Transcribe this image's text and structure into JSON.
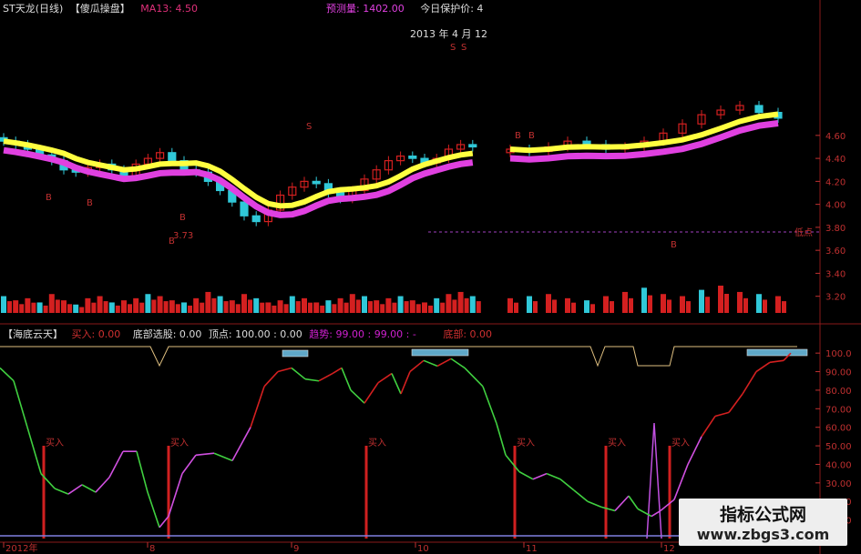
{
  "main_header": {
    "stock": "ST天龙(日线)",
    "tag": "【傻瓜操盘】",
    "ma": "MA13: 4.50",
    "predict": "预测量: 1402.00",
    "protect": "今日保护价: 4",
    "date": "2013 年 4 月 12"
  },
  "sub_header": {
    "name": "【海底云天】",
    "buy": "买入: 0.00",
    "bottom_pick": "底部选股: 0.00",
    "top": "顶点: 100.00 : 0.00",
    "trend": "趋势: 99.00 : 99.00 : -",
    "bottom": "底部: 0.00"
  },
  "watermark": {
    "line1": "指标公式网",
    "line2": "www.zbgs3.com"
  },
  "colors": {
    "up": "#d42020",
    "down": "#30c8d8",
    "bull_band": "#ffff40",
    "bear_band": "#e040e0",
    "grid": "#8a1a1a"
  },
  "chart_data": [
    {
      "type": "candlestick",
      "title": "ST天龙(日线)",
      "y_ticks": [
        "4.60",
        "4.40",
        "4.20",
        "4.00",
        "3.80",
        "3.60",
        "3.40",
        "3.20"
      ],
      "ylim": [
        3.15,
        4.67
      ],
      "x_ticks": [
        "2012年",
        "8",
        "9",
        "10",
        "11",
        "12"
      ],
      "annotations": {
        "low_value": "3.73",
        "low_label": "低点",
        "buy_marks": [
          "B",
          "B",
          "B",
          "B",
          "B",
          "B",
          "B"
        ],
        "sell_marks": [
          "S",
          "S",
          "S"
        ]
      },
      "close_series": [
        4.55,
        4.52,
        4.48,
        4.43,
        4.38,
        4.3,
        4.28,
        4.32,
        4.35,
        4.3,
        4.25,
        4.35,
        4.4,
        4.45,
        4.38,
        4.3,
        4.28,
        4.2,
        4.12,
        4.02,
        3.9,
        3.85,
        3.95,
        4.08,
        4.15,
        4.2,
        4.18,
        4.1,
        4.05,
        4.12,
        4.22,
        4.3,
        4.38,
        4.42,
        4.4,
        4.36,
        4.4,
        4.48,
        4.52,
        4.5,
        4.45,
        4.48,
        4.46,
        4.5,
        4.55,
        4.52,
        4.48,
        4.5,
        4.55,
        4.62,
        4.7,
        4.78,
        4.82,
        4.86,
        4.8,
        4.75
      ],
      "volume_series": [
        8,
        6,
        7,
        5,
        9,
        6,
        4,
        7,
        8,
        5,
        6,
        7,
        9,
        8,
        6,
        5,
        7,
        10,
        8,
        6,
        9,
        7,
        5,
        6,
        8,
        7,
        5,
        6,
        7,
        9,
        8,
        6,
        7,
        8,
        6,
        5,
        7,
        9,
        10,
        8,
        6,
        7,
        8,
        9,
        7,
        6,
        8,
        10,
        12,
        9,
        8,
        11,
        13,
        10,
        9,
        8
      ]
    },
    {
      "type": "line",
      "title": "【海底云天】",
      "y_ticks": [
        "100.0",
        "90.00",
        "80.00",
        "70.00",
        "60.00",
        "50.00",
        "40.00",
        "30.00",
        "20.00",
        "10.00"
      ],
      "ylim": [
        0,
        104
      ],
      "buy_label": "买入",
      "buy_signals_x": [
        48,
        185,
        402,
        565,
        665,
        735
      ],
      "osc_series": [
        [
          0,
          92
        ],
        [
          15,
          85
        ],
        [
          30,
          60
        ],
        [
          45,
          35
        ],
        [
          60,
          27
        ],
        [
          75,
          24
        ],
        [
          90,
          29
        ],
        [
          105,
          25
        ],
        [
          120,
          33
        ],
        [
          135,
          47
        ],
        [
          150,
          47
        ],
        [
          162,
          25
        ],
        [
          175,
          6
        ],
        [
          185,
          12
        ],
        [
          200,
          35
        ],
        [
          215,
          45
        ],
        [
          235,
          46
        ],
        [
          255,
          42
        ],
        [
          275,
          60
        ],
        [
          290,
          82
        ],
        [
          305,
          90
        ],
        [
          320,
          92
        ],
        [
          335,
          86
        ],
        [
          350,
          85
        ],
        [
          365,
          89
        ],
        [
          375,
          92
        ],
        [
          385,
          80
        ],
        [
          400,
          73
        ],
        [
          415,
          84
        ],
        [
          430,
          89
        ],
        [
          440,
          78
        ],
        [
          450,
          90
        ],
        [
          465,
          96
        ],
        [
          480,
          93
        ],
        [
          495,
          97
        ],
        [
          510,
          92
        ],
        [
          530,
          82
        ],
        [
          545,
          62
        ],
        [
          555,
          45
        ],
        [
          570,
          36
        ],
        [
          585,
          32
        ],
        [
          600,
          35
        ],
        [
          615,
          32
        ],
        [
          630,
          26
        ],
        [
          645,
          20
        ],
        [
          660,
          17
        ],
        [
          675,
          15
        ],
        [
          690,
          23
        ],
        [
          700,
          16
        ],
        [
          715,
          12
        ],
        [
          725,
          15
        ],
        [
          740,
          21
        ],
        [
          755,
          40
        ],
        [
          770,
          55
        ],
        [
          785,
          66
        ],
        [
          800,
          68
        ],
        [
          815,
          78
        ],
        [
          830,
          90
        ],
        [
          845,
          95
        ],
        [
          860,
          96
        ],
        [
          868,
          100
        ]
      ]
    }
  ]
}
